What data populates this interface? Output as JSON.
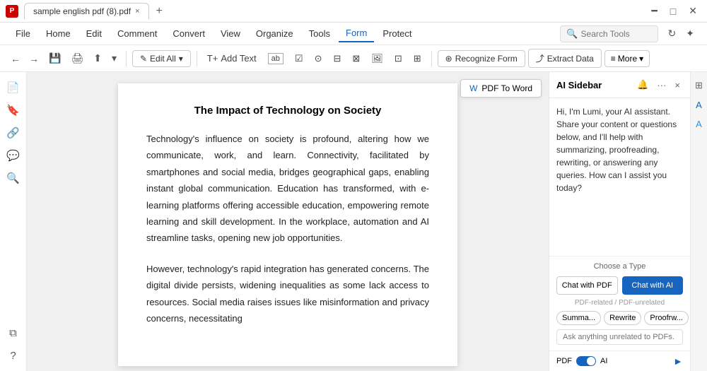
{
  "titlebar": {
    "app_icon": "P",
    "tab_label": "sample english pdf (8).pdf",
    "tab_close": "×",
    "tab_new": "+"
  },
  "menu": {
    "items": [
      {
        "id": "home",
        "label": "Home"
      },
      {
        "id": "edit",
        "label": "Edit"
      },
      {
        "id": "comment",
        "label": "Comment"
      },
      {
        "id": "convert",
        "label": "Convert"
      },
      {
        "id": "view",
        "label": "View"
      },
      {
        "id": "organize",
        "label": "Organize"
      },
      {
        "id": "tools",
        "label": "Tools"
      },
      {
        "id": "form",
        "label": "Form"
      },
      {
        "id": "protect",
        "label": "Protect"
      }
    ],
    "active": "Form",
    "search_placeholder": "Search Tools"
  },
  "actionbar": {
    "edit_all_label": "Edit All",
    "add_text_label": "Add Text",
    "recognize_label": "Recognize Form",
    "extract_label": "Extract Data",
    "more_label": "More"
  },
  "document": {
    "pdf_to_word": "PDF To Word",
    "page_title": "The Impact of Technology on Society",
    "paragraphs": [
      "Technology's influence on society is profound, altering how we communicate, work, and learn. Connectivity, facilitated by smartphones and social media, bridges geographical gaps, enabling instant global communication. Education has transformed, with e-learning platforms offering accessible education, empowering remote learning and skill development. In the workplace, automation and AI streamline tasks, opening new job opportunities.",
      "However, technology's rapid integration has generated concerns. The digital divide persists, widening inequalities as some lack access to resources. Social media raises issues like misinformation and privacy concerns, necessitating"
    ]
  },
  "ai_sidebar": {
    "title": "AI Sidebar",
    "message": "Hi, I'm Lumi, your AI assistant. Share your content or questions below, and I'll help with summarizing, proofreading, rewriting, or answering any queries. How can I assist you today?",
    "choose_type_label": "Choose a Type",
    "chat_with_pdf_label": "Chat with PDF",
    "chat_with_ai_label": "Chat with AI",
    "pdf_related_label": "PDF-related / PDF-unrelated",
    "quick_btns": [
      {
        "label": "Summa..."
      },
      {
        "label": "Rewrite"
      },
      {
        "label": "Proofrw..."
      }
    ],
    "input_placeholder": "Ask anything unrelated to PDFs. Press '#' for Prompts.",
    "footer_pdf_label": "PDF",
    "footer_ai_label": "AI"
  }
}
